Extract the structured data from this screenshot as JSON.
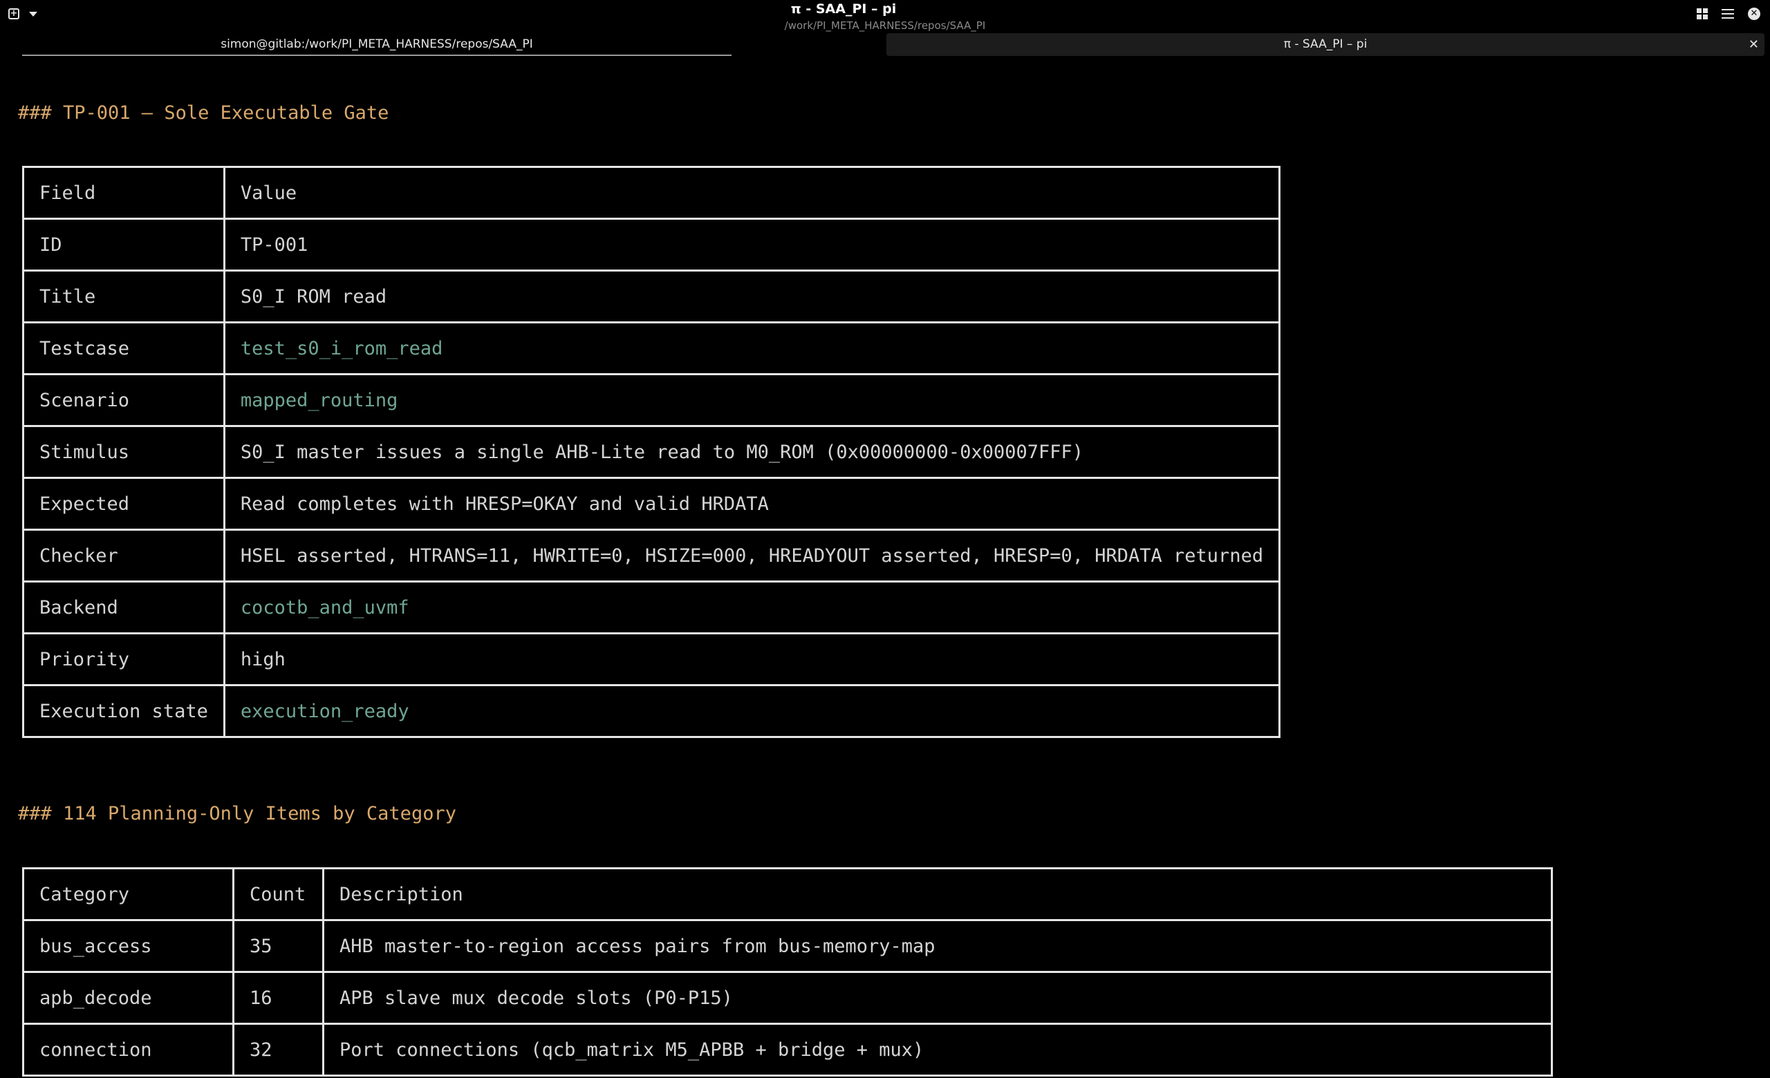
{
  "window": {
    "title": "π - SAA_PI – pi",
    "subtitle": "/work/PI_META_HARNESS/repos/SAA_PI"
  },
  "tabs": [
    {
      "label": "simon@gitlab:/work/PI_META_HARNESS/repos/SAA_PI"
    },
    {
      "label": "π - SAA_PI – pi"
    }
  ],
  "icons": {
    "new_tab": "new-tab-icon",
    "dropdown": "chevron-down-icon",
    "grid": "grid-icon",
    "menu": "hamburger-menu-icon",
    "close": "close-icon"
  },
  "colors": {
    "background": "#000000",
    "heading": "#d9a86b",
    "code": "#6fa693",
    "text": "#d4d4d4",
    "border": "#e6e6e6"
  },
  "section1": {
    "heading": "### TP-001 — Sole Executable Gate",
    "header": [
      "Field",
      "Value"
    ],
    "rows": [
      {
        "field": "ID",
        "value": "TP-001",
        "code": false
      },
      {
        "field": "Title",
        "value": "S0_I ROM read",
        "code": false
      },
      {
        "field": "Testcase",
        "value": "test_s0_i_rom_read",
        "code": true
      },
      {
        "field": "Scenario",
        "value": "mapped_routing",
        "code": true
      },
      {
        "field": "Stimulus",
        "value": "S0_I master issues a single AHB-Lite read to M0_ROM (0x00000000-0x00007FFF)",
        "code": false
      },
      {
        "field": "Expected",
        "value": "Read completes with HRESP=OKAY and valid HRDATA",
        "code": false
      },
      {
        "field": "Checker",
        "value": "HSEL asserted, HTRANS=11, HWRITE=0, HSIZE=000, HREADYOUT asserted, HRESP=0, HRDATA returned",
        "code": false
      },
      {
        "field": "Backend",
        "value": "cocotb_and_uvmf",
        "code": true
      },
      {
        "field": "Priority",
        "value": "high",
        "code": false
      },
      {
        "field": "Execution state",
        "value": "execution_ready",
        "code": true
      }
    ]
  },
  "section2": {
    "heading": "### 114 Planning-Only Items by Category",
    "header": [
      "Category",
      "Count",
      "Description"
    ],
    "rows": [
      {
        "category": "bus_access",
        "count": "35",
        "description": "AHB master-to-region access pairs from bus-memory-map"
      },
      {
        "category": "apb_decode",
        "count": "16",
        "description": "APB slave mux decode slots (P0-P15)"
      },
      {
        "category": "connection",
        "count": "32",
        "description": "Port connections (qcb_matrix M5_APBB + bridge + mux)"
      }
    ]
  }
}
